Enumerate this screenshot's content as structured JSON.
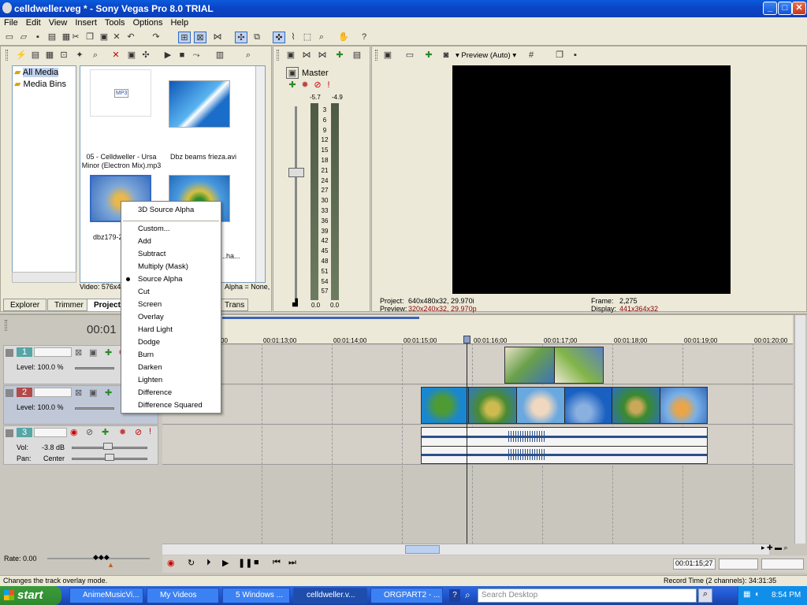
{
  "window": {
    "title": "celldweller.veg * - Sony Vegas Pro 8.0 TRIAL",
    "minimize": "_",
    "maximize": "□",
    "close": "✕"
  },
  "menu": [
    "File",
    "Edit",
    "View",
    "Insert",
    "Tools",
    "Options",
    "Help"
  ],
  "toolbar_icons": [
    "new-icon",
    "open-icon",
    "save-icon",
    "render-icon",
    "properties-icon",
    "cut-icon",
    "copy-icon",
    "paste-icon",
    "delete-icon",
    "undo-icon",
    "redo-icon",
    "snap-icon",
    "auto-ripple-icon",
    "crossfade-icon",
    "lock-envelopes-icon",
    "ignore-grouping-icon",
    "normal-edit-tool-icon",
    "envelope-tool-icon",
    "selection-tool-icon",
    "zoom-tool-icon",
    "pan-icon",
    "help-icon"
  ],
  "explorer": {
    "tree": [
      "All Media",
      "Media Bins"
    ],
    "items": [
      {
        "caption": "05 - Celldweller - Ursa Minor (Electron Mix).mp3",
        "icon": "mp3-icon",
        "badge": "MP3"
      },
      {
        "caption": "Dbz beams frieza.avi",
        "icon": "video-thumbnail"
      },
      {
        "caption": "dbz179-2",
        "icon": "video-thumbnail"
      },
      {
        "caption": "...ha...",
        "icon": "video-thumbnail"
      }
    ],
    "status_left": "Video: 576x43",
    "status_right": "Alpha = None,",
    "tabs": [
      "Explorer",
      "Trimmer",
      "Project",
      "Trans"
    ]
  },
  "mixer": {
    "bus": "Master",
    "peak_left": "-5.7",
    "peak_right": "-4.9",
    "scale": [
      "3",
      "6",
      "9",
      "12",
      "15",
      "18",
      "21",
      "24",
      "27",
      "30",
      "33",
      "36",
      "39",
      "42",
      "45",
      "48",
      "51",
      "54",
      "57"
    ],
    "readout_left": "0.0",
    "readout_right": "0.0"
  },
  "preview": {
    "quality": "Preview (Auto)",
    "project_label": "Project:",
    "project_value": "640x480x32, 29.970i",
    "preview_label": "Preview:",
    "preview_value": "320x240x32, 29.970p",
    "frame_label": "Frame:",
    "frame_value": "2,275",
    "display_label": "Display:",
    "display_value": "441x364x32"
  },
  "context_menu": {
    "items": [
      "3D Source Alpha",
      "Custom...",
      "Add",
      "Subtract",
      "Multiply (Mask)",
      "Source Alpha",
      "Cut",
      "Screen",
      "Overlay",
      "Hard Light",
      "Dodge",
      "Burn",
      "Darken",
      "Lighten",
      "Difference",
      "Difference Squared"
    ],
    "selected": "Source Alpha"
  },
  "timeline": {
    "cursor_time": "00:01",
    "ruler": [
      "00:01:13;00",
      "00:01:14;00",
      "00:01:15;00",
      "00:01:16;00",
      "00:01:17;00",
      "00:01:18;00",
      "00:01:19;00",
      "00:01:20;00"
    ],
    "ruler_first": "00",
    "tracks": [
      {
        "number": "1",
        "level": "Level: 100.0 %"
      },
      {
        "number": "2",
        "level": "Level: 100.0 %"
      },
      {
        "number": "3",
        "vol_label": "Vol:",
        "vol_value": "-3.8 dB",
        "pan_label": "Pan:",
        "pan_value": "Center"
      }
    ],
    "rate": "Rate: 0.00",
    "position": "00:01:15;27"
  },
  "status": {
    "hint": "Changes the track overlay mode.",
    "record_time": "Record Time (2 channels): 34:31:35"
  },
  "taskbar": {
    "start": "start",
    "tasks": [
      "AnimeMusicVi...",
      "My Videos",
      "5 Windows ...",
      "celldweller.v...",
      "ORGPART2 - ..."
    ],
    "active_task": "celldweller.v...",
    "search_placeholder": "Search Desktop",
    "clock": "8:54 PM"
  },
  "colors": {
    "accent": "#316ac5",
    "title_bar": "#0a4fd0",
    "taskbar": "#245edb",
    "start": "#3c9b3c",
    "preview_value": "#8b0000"
  }
}
